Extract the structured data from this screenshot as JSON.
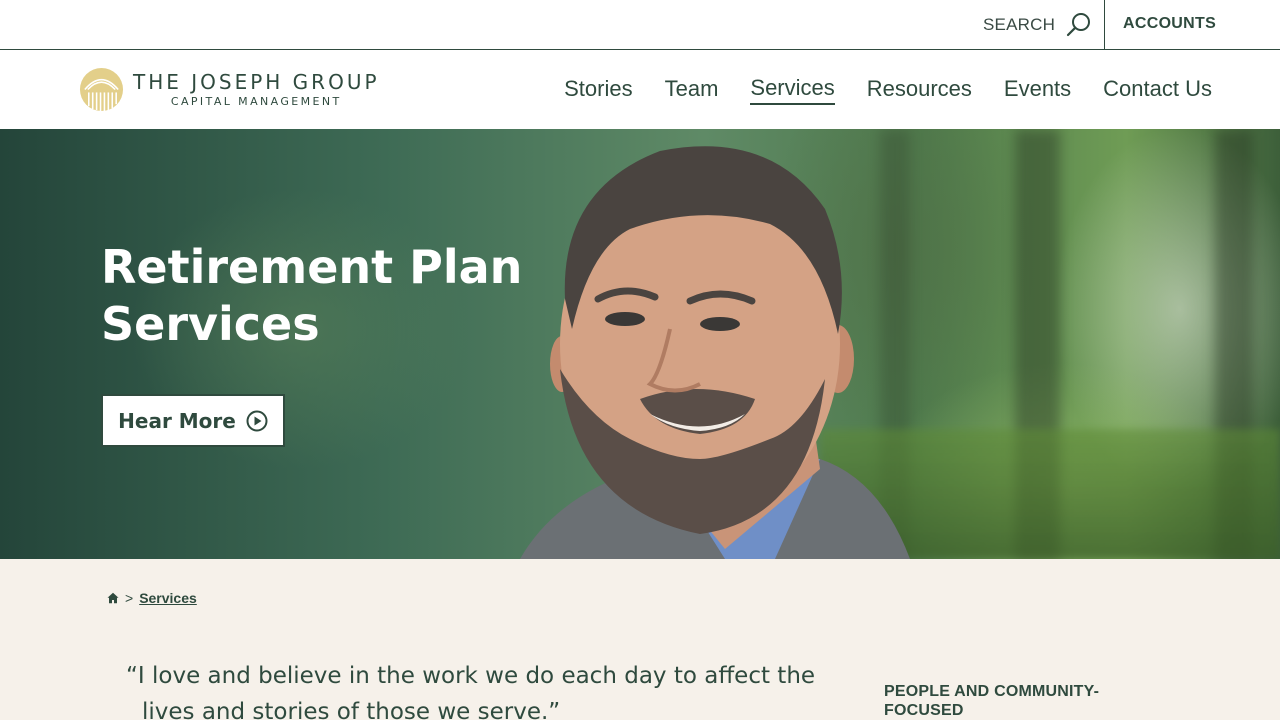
{
  "utility": {
    "search_label": "SEARCH",
    "search_icon": "search-icon",
    "accounts_label": "ACCOUNTS"
  },
  "header": {
    "logo": {
      "name": "THE JOSEPH GROUP",
      "subtitle": "CAPITAL MANAGEMENT",
      "mark_color": "#e3cf8a"
    },
    "nav": [
      {
        "label": "Stories",
        "active": false
      },
      {
        "label": "Team",
        "active": false
      },
      {
        "label": "Services",
        "active": true
      },
      {
        "label": "Resources",
        "active": false
      },
      {
        "label": "Events",
        "active": false
      },
      {
        "label": "Contact Us",
        "active": false
      }
    ]
  },
  "hero": {
    "title": "Retirement Plan Services",
    "button_label": "Hear More",
    "button_icon": "play-circle-icon"
  },
  "breadcrumb": {
    "home_icon": "home-icon",
    "separator": ">",
    "current": "Services"
  },
  "main": {
    "quote": "“I love and believe in the work we do each day to affect the lives and stories of those we serve.”",
    "side_heading": "PEOPLE AND COMMUNITY-FOCUSED"
  },
  "colors": {
    "brand_green": "#2f4a3e",
    "content_background": "#f6f1ea",
    "logo_gold": "#e3cf8a"
  }
}
